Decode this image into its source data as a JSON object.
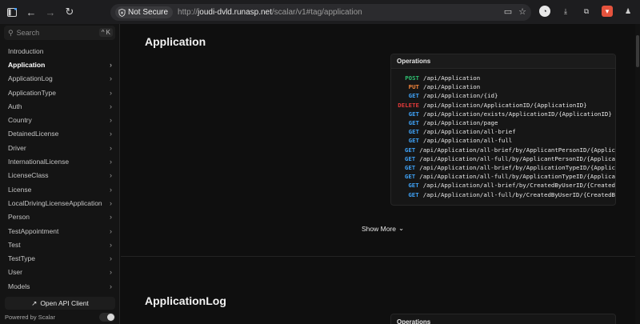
{
  "browser": {
    "security_label": "Not Secure",
    "url_prefix": "http://",
    "url_host": "joudi-dvld.runasp.net",
    "url_path": "/scalar/v1#tag/application"
  },
  "sidebar": {
    "search_placeholder": "Search",
    "search_shortcut": "^ K",
    "items": [
      {
        "label": "Introduction",
        "has_chevron": false
      },
      {
        "label": "Application",
        "has_chevron": true,
        "active": true
      },
      {
        "label": "ApplicationLog",
        "has_chevron": true
      },
      {
        "label": "ApplicationType",
        "has_chevron": true
      },
      {
        "label": "Auth",
        "has_chevron": true
      },
      {
        "label": "Country",
        "has_chevron": true
      },
      {
        "label": "DetainedLicense",
        "has_chevron": true
      },
      {
        "label": "Driver",
        "has_chevron": true
      },
      {
        "label": "InternationalLicense",
        "has_chevron": true
      },
      {
        "label": "LicenseClass",
        "has_chevron": true
      },
      {
        "label": "License",
        "has_chevron": true
      },
      {
        "label": "LocalDrivingLicenseApplication",
        "has_chevron": true
      },
      {
        "label": "Person",
        "has_chevron": true
      },
      {
        "label": "TestAppointment",
        "has_chevron": true
      },
      {
        "label": "Test",
        "has_chevron": true
      },
      {
        "label": "TestType",
        "has_chevron": true
      },
      {
        "label": "User",
        "has_chevron": true
      },
      {
        "label": "Models",
        "has_chevron": true
      }
    ],
    "open_api_client_label": "Open API Client",
    "powered_by": "Powered by Scalar"
  },
  "main": {
    "section_title": "Application",
    "operations_header": "Operations",
    "operations": [
      {
        "method": "POST",
        "path": "/api/Application"
      },
      {
        "method": "PUT",
        "path": "/api/Application"
      },
      {
        "method": "GET",
        "path": "/api/Application/{id}"
      },
      {
        "method": "DELETE",
        "path": "/api/Application/ApplicationID/{ApplicationID}"
      },
      {
        "method": "GET",
        "path": "/api/Application/exists/ApplicationID/{ApplicationID}"
      },
      {
        "method": "GET",
        "path": "/api/Application/page"
      },
      {
        "method": "GET",
        "path": "/api/Application/all-brief"
      },
      {
        "method": "GET",
        "path": "/api/Application/all-full"
      },
      {
        "method": "GET",
        "path": "/api/Application/all-brief/by/ApplicantPersonID/{Applic"
      },
      {
        "method": "GET",
        "path": "/api/Application/all-full/by/ApplicantPersonID/{Applica"
      },
      {
        "method": "GET",
        "path": "/api/Application/all-brief/by/ApplicationTypeID/{Applic"
      },
      {
        "method": "GET",
        "path": "/api/Application/all-full/by/ApplicationTypeID/{Applica"
      },
      {
        "method": "GET",
        "path": "/api/Application/all-brief/by/CreatedByUserID/{Created"
      },
      {
        "method": "GET",
        "path": "/api/Application/all-full/by/CreatedByUserID/{CreatedB"
      }
    ],
    "show_more_label": "Show More",
    "next_section_title": "ApplicationLog",
    "next_operations_header": "Operations"
  }
}
